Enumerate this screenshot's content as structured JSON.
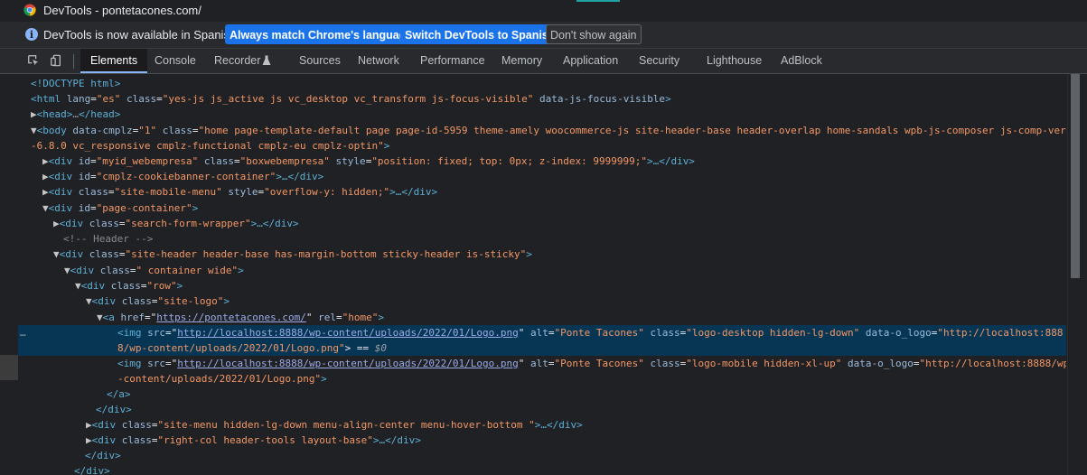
{
  "window": {
    "title": "DevTools - pontetacones.com/"
  },
  "infobar": {
    "message": "DevTools is now available in Spanish!",
    "btn_match": "Always match Chrome's language",
    "btn_switch": "Switch DevTools to Spanish",
    "btn_dont_show": "Don't show again"
  },
  "tabs": [
    {
      "label": "Elements"
    },
    {
      "label": "Console"
    },
    {
      "label": "Recorder"
    },
    {
      "label": "Sources"
    },
    {
      "label": "Network"
    },
    {
      "label": "Performance"
    },
    {
      "label": "Memory"
    },
    {
      "label": "Application"
    },
    {
      "label": "Security"
    },
    {
      "label": "Lighthouse"
    },
    {
      "label": "AdBlock"
    }
  ],
  "dom": {
    "l1": "<!DOCTYPE html>",
    "l2_tag": "<html",
    "l2_a1": " lang",
    "l2_v1": "\"es\"",
    "l2_a2": " class",
    "l2_v2": "\"yes-js js_active js vc_desktop vc_transform js-focus-visible\"",
    "l2_a3": " data-js-focus-visible",
    "l2_end": ">",
    "l3_tag_open": "<head>",
    "l3_ellipsis": "…",
    "l3_tag_close": "</head>",
    "l4_tag": "<body",
    "l4_a1": " data-cmplz",
    "l4_v1": "\"1\"",
    "l4_a2": " class",
    "l4_v2a": "\"home page-template-default page page-id-5959 theme-amely woocommerce-js site-header-base header-overlap home-sandals wpb-js-composer js-comp-ver",
    "l5_v2b": "-6.8.0 vc_responsive cmplz-functional cmplz-eu cmplz-optin\"",
    "l6_tag": "<div",
    "l6_a1": " id",
    "l6_v1": "\"myid_webempresa\"",
    "l6_a2": " class",
    "l6_v2": "\"boxwebempresa\"",
    "l6_a3": " style",
    "l6_v3": "\"position: fixed; top: 0px; z-index: 9999999;\"",
    "l6_end": ">…</div>",
    "l7_a1": " id",
    "l7_v1": "\"cmplz-cookiebanner-container\"",
    "l7_end": ">…</div>",
    "l8_a1": " class",
    "l8_v1": "\"site-mobile-menu\"",
    "l8_a2": " style",
    "l8_v2": "\"overflow-y: hidden;\"",
    "l8_end": ">…</div>",
    "l9_a1": " id",
    "l9_v1": "\"page-container\"",
    "l10_a1": " class",
    "l10_v1": "\"search-form-wrapper\"",
    "l10_end": ">…</div>",
    "l11": "<!-- Header -->",
    "l12_a1": " class",
    "l12_v1": "\"site-header header-base has-margin-bottom sticky-header is-sticky\"",
    "l13_a1": " class",
    "l13_v1": "\" container wide\"",
    "l14_a1": " class",
    "l14_v1": "\"row\"",
    "l15_a1": " class",
    "l15_v1": "\"site-logo\"",
    "l16_tag": "<a",
    "l16_a1": " href",
    "l16_v1": "https://pontetacones.com/",
    "l16_a2": " rel",
    "l16_v2": "\"home\"",
    "l17_tag": "<img",
    "l17_a1": " src",
    "l17_v1": "http://localhost:8888/wp-content/uploads/2022/01/Logo.png",
    "l17_a2": " alt",
    "l17_v2": "\"Ponte Tacones\"",
    "l17_a3": " class",
    "l17_v3": "\"logo-desktop hidden-lg-down\"",
    "l17_a4": " data-o_logo",
    "l17_v4a": "\"http://localhost:888",
    "l18_v4b": "8/wp-content/uploads/2022/01/Logo.png\"",
    "l18_eq": "> == ",
    "l18_sel": "$0",
    "l19_a3": " class",
    "l19_v3": "\"logo-mobile hidden-xl-up\"",
    "l19_v4a": "\"http://localhost:8888/wp",
    "l20_v4b": "-content/uploads/2022/01/Logo.png\"",
    "l21": "</a>",
    "l22": "</div>",
    "l23_a1": " class",
    "l23_v1": "\"site-menu hidden-lg-down menu-align-center menu-hover-bottom \"",
    "l23_end": ">…</div>",
    "l24_a1": " class",
    "l24_v1": "\"right-col header-tools layout-base\"",
    "l24_end": ">…</div>",
    "l25": "</div>",
    "l26": "</div>",
    "dots": "…"
  }
}
